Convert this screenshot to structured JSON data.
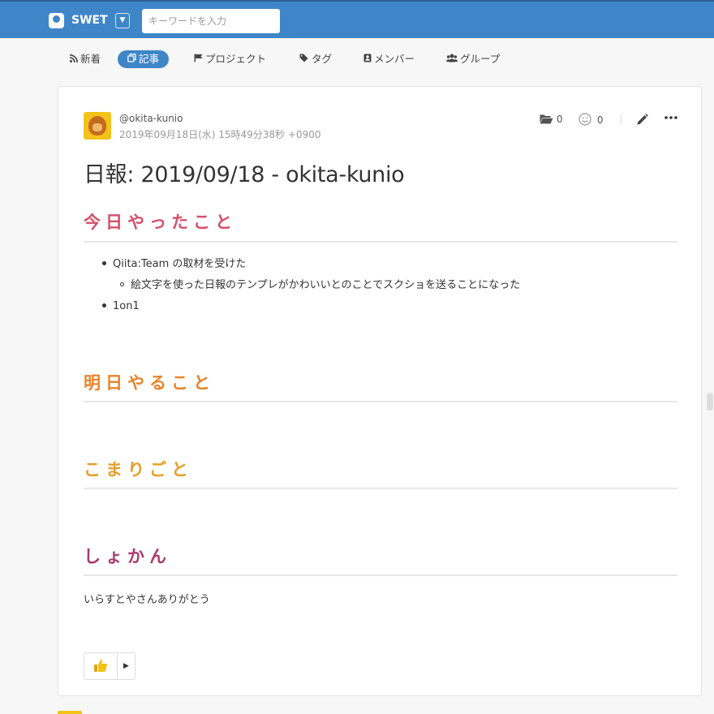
{
  "header": {
    "team_name": "SWET",
    "search_placeholder": "キーワードを入力",
    "brand_color": "#3f86c8"
  },
  "nav": {
    "items": [
      {
        "label": "新着",
        "icon": "rss-icon"
      },
      {
        "label": "記事",
        "icon": "copy-icon",
        "active": true
      },
      {
        "label": "プロジェクト",
        "icon": "flag-icon"
      },
      {
        "label": "タグ",
        "icon": "tags-icon"
      },
      {
        "label": "メンバー",
        "icon": "address-book-icon"
      },
      {
        "label": "グループ",
        "icon": "users-icon"
      }
    ]
  },
  "post": {
    "author": "@okita-kunio",
    "date": "2019年09月18日(水) 15時49分38秒 +0900",
    "folder_count": "0",
    "reaction_count": "0",
    "title": "日報: 2019/09/18 - okita-kunio",
    "sections": [
      {
        "heading": "今日やったこと"
      },
      {
        "heading": "明日やること"
      },
      {
        "heading": "こまりごと"
      },
      {
        "heading": "しょかん"
      }
    ],
    "done_items": [
      "Qiita:Team の取材を受けた",
      "1on1"
    ],
    "done_subitem": "絵文字を使った日報のテンプレがかわいいとのことでスクショを送ることになった",
    "impression_text": "いらすとやさんありがとう"
  }
}
